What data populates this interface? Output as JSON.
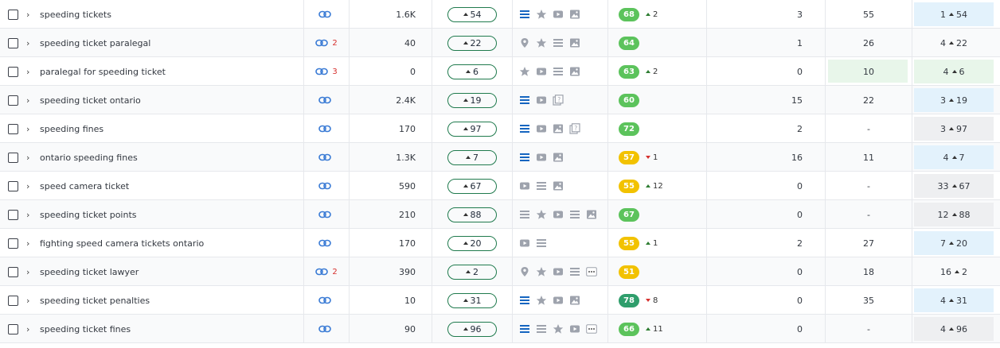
{
  "colors": {
    "score_green": "#5cc35c",
    "score_dark_green": "#2f9e6c",
    "score_yellow": "#f2c200",
    "pos_blue": "#e3f2fc",
    "pos_grey": "#eeeff1",
    "pos_green": "#e8f6ea",
    "icon_blue": "#1565c0",
    "icon_grey": "#9ea3ad",
    "link_blue": "#3a7bd5"
  },
  "rows": [
    {
      "keyword": "speeding tickets",
      "link_count": "",
      "volume": "1.6K",
      "kd_delta": "54",
      "serp": [
        "list-blue",
        "star",
        "video",
        "image"
      ],
      "score": "68",
      "score_color": "green",
      "delta_dir": "up",
      "delta": "2",
      "n1": "3",
      "n2": "55",
      "n2_highlight": false,
      "pos": "1",
      "pos_delta": "54",
      "pos_bg": "blue"
    },
    {
      "keyword": "speeding ticket paralegal",
      "link_count": "2",
      "volume": "40",
      "kd_delta": "22",
      "serp": [
        "pin",
        "star",
        "list",
        "image"
      ],
      "score": "64",
      "score_color": "green",
      "delta_dir": "",
      "delta": "",
      "n1": "1",
      "n2": "26",
      "n2_highlight": false,
      "pos": "4",
      "pos_delta": "22",
      "pos_bg": "none"
    },
    {
      "keyword": "paralegal for speeding ticket",
      "link_count": "3",
      "volume": "0",
      "kd_delta": "6",
      "serp": [
        "star",
        "video",
        "list",
        "image"
      ],
      "score": "63",
      "score_color": "green",
      "delta_dir": "up",
      "delta": "2",
      "n1": "0",
      "n2": "10",
      "n2_highlight": true,
      "pos": "4",
      "pos_delta": "6",
      "pos_bg": "green"
    },
    {
      "keyword": "speeding ticket ontario",
      "link_count": "",
      "volume": "2.4K",
      "kd_delta": "19",
      "serp": [
        "list-blue",
        "video",
        "faq"
      ],
      "score": "60",
      "score_color": "green",
      "delta_dir": "",
      "delta": "",
      "n1": "15",
      "n2": "22",
      "n2_highlight": false,
      "pos": "3",
      "pos_delta": "19",
      "pos_bg": "blue"
    },
    {
      "keyword": "speeding fines",
      "link_count": "",
      "volume": "170",
      "kd_delta": "97",
      "serp": [
        "list-blue",
        "video",
        "image",
        "faq"
      ],
      "score": "72",
      "score_color": "green",
      "delta_dir": "",
      "delta": "",
      "n1": "2",
      "n2": "-",
      "n2_highlight": false,
      "pos": "3",
      "pos_delta": "97",
      "pos_bg": "grey"
    },
    {
      "keyword": "ontario speeding fines",
      "link_count": "",
      "volume": "1.3K",
      "kd_delta": "7",
      "serp": [
        "list-blue",
        "video",
        "image"
      ],
      "score": "57",
      "score_color": "yellow",
      "delta_dir": "down",
      "delta": "1",
      "n1": "16",
      "n2": "11",
      "n2_highlight": false,
      "pos": "4",
      "pos_delta": "7",
      "pos_bg": "blue"
    },
    {
      "keyword": "speed camera ticket",
      "link_count": "",
      "volume": "590",
      "kd_delta": "67",
      "serp": [
        "video",
        "list",
        "image"
      ],
      "score": "55",
      "score_color": "yellow",
      "delta_dir": "up",
      "delta": "12",
      "n1": "0",
      "n2": "-",
      "n2_highlight": false,
      "pos": "33",
      "pos_delta": "67",
      "pos_bg": "grey"
    },
    {
      "keyword": "speeding ticket points",
      "link_count": "",
      "volume": "210",
      "kd_delta": "88",
      "serp": [
        "list",
        "star",
        "video",
        "list",
        "image"
      ],
      "score": "67",
      "score_color": "green",
      "delta_dir": "",
      "delta": "",
      "n1": "0",
      "n2": "-",
      "n2_highlight": false,
      "pos": "12",
      "pos_delta": "88",
      "pos_bg": "grey"
    },
    {
      "keyword": "fighting speed camera tickets ontario",
      "link_count": "",
      "volume": "170",
      "kd_delta": "20",
      "serp": [
        "video",
        "list"
      ],
      "score": "55",
      "score_color": "yellow",
      "delta_dir": "up",
      "delta": "1",
      "n1": "2",
      "n2": "27",
      "n2_highlight": false,
      "pos": "7",
      "pos_delta": "20",
      "pos_bg": "blue"
    },
    {
      "keyword": "speeding ticket lawyer",
      "link_count": "2",
      "volume": "390",
      "kd_delta": "2",
      "serp": [
        "pin",
        "star",
        "video",
        "list",
        "more"
      ],
      "score": "51",
      "score_color": "yellow",
      "delta_dir": "",
      "delta": "",
      "n1": "0",
      "n2": "18",
      "n2_highlight": false,
      "pos": "16",
      "pos_delta": "2",
      "pos_bg": "none"
    },
    {
      "keyword": "speeding ticket penalties",
      "link_count": "",
      "volume": "10",
      "kd_delta": "31",
      "serp": [
        "list-blue",
        "star",
        "video",
        "image"
      ],
      "score": "78",
      "score_color": "dark_green",
      "delta_dir": "down",
      "delta": "8",
      "n1": "0",
      "n2": "35",
      "n2_highlight": false,
      "pos": "4",
      "pos_delta": "31",
      "pos_bg": "blue"
    },
    {
      "keyword": "speeding ticket fines",
      "link_count": "",
      "volume": "90",
      "kd_delta": "96",
      "serp": [
        "list-blue",
        "list",
        "star",
        "video",
        "more"
      ],
      "score": "66",
      "score_color": "green",
      "delta_dir": "up",
      "delta": "11",
      "n1": "0",
      "n2": "-",
      "n2_highlight": false,
      "pos": "4",
      "pos_delta": "96",
      "pos_bg": "grey"
    }
  ]
}
